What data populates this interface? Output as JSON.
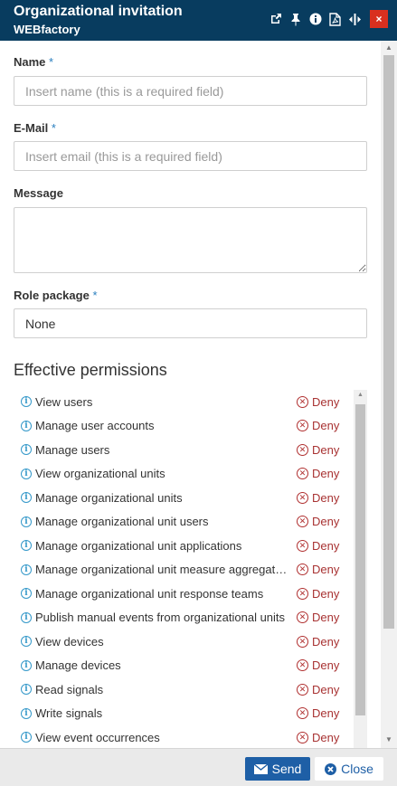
{
  "dialog": {
    "title": "Organizational invitation",
    "subtitle": "WEBfactory",
    "header_icons": [
      "external-link-icon",
      "pin-icon",
      "info-icon",
      "pdf-icon",
      "resize-icon"
    ],
    "close_label": "×"
  },
  "form": {
    "name": {
      "label": "Name",
      "required_mark": "*",
      "value": "",
      "placeholder": "Insert name (this is a required field)"
    },
    "email": {
      "label": "E-Mail",
      "required_mark": "*",
      "value": "",
      "placeholder": "Insert email (this is a required field)"
    },
    "message": {
      "label": "Message",
      "value": ""
    },
    "role_package": {
      "label": "Role package",
      "required_mark": "*",
      "selected": "None"
    }
  },
  "permissions": {
    "title": "Effective permissions",
    "deny_label": "Deny",
    "items": [
      {
        "name": "View users",
        "status": "Deny"
      },
      {
        "name": "Manage user accounts",
        "status": "Deny"
      },
      {
        "name": "Manage users",
        "status": "Deny"
      },
      {
        "name": "View organizational units",
        "status": "Deny"
      },
      {
        "name": "Manage organizational units",
        "status": "Deny"
      },
      {
        "name": "Manage organizational unit users",
        "status": "Deny"
      },
      {
        "name": "Manage organizational unit applications",
        "status": "Deny"
      },
      {
        "name": "Manage organizational unit measure aggregations",
        "status": "Deny"
      },
      {
        "name": "Manage organizational unit response teams",
        "status": "Deny"
      },
      {
        "name": "Publish manual events from organizational units",
        "status": "Deny"
      },
      {
        "name": "View devices",
        "status": "Deny"
      },
      {
        "name": "Manage devices",
        "status": "Deny"
      },
      {
        "name": "Read signals",
        "status": "Deny"
      },
      {
        "name": "Write signals",
        "status": "Deny"
      },
      {
        "name": "View event occurrences",
        "status": "Deny"
      }
    ]
  },
  "footer": {
    "send_label": "Send",
    "close_label": "Close"
  },
  "colors": {
    "header_bg": "#083c5f",
    "close_btn": "#d9301f",
    "primary": "#1e5fa6",
    "deny": "#a83232",
    "info": "#3498c9"
  }
}
